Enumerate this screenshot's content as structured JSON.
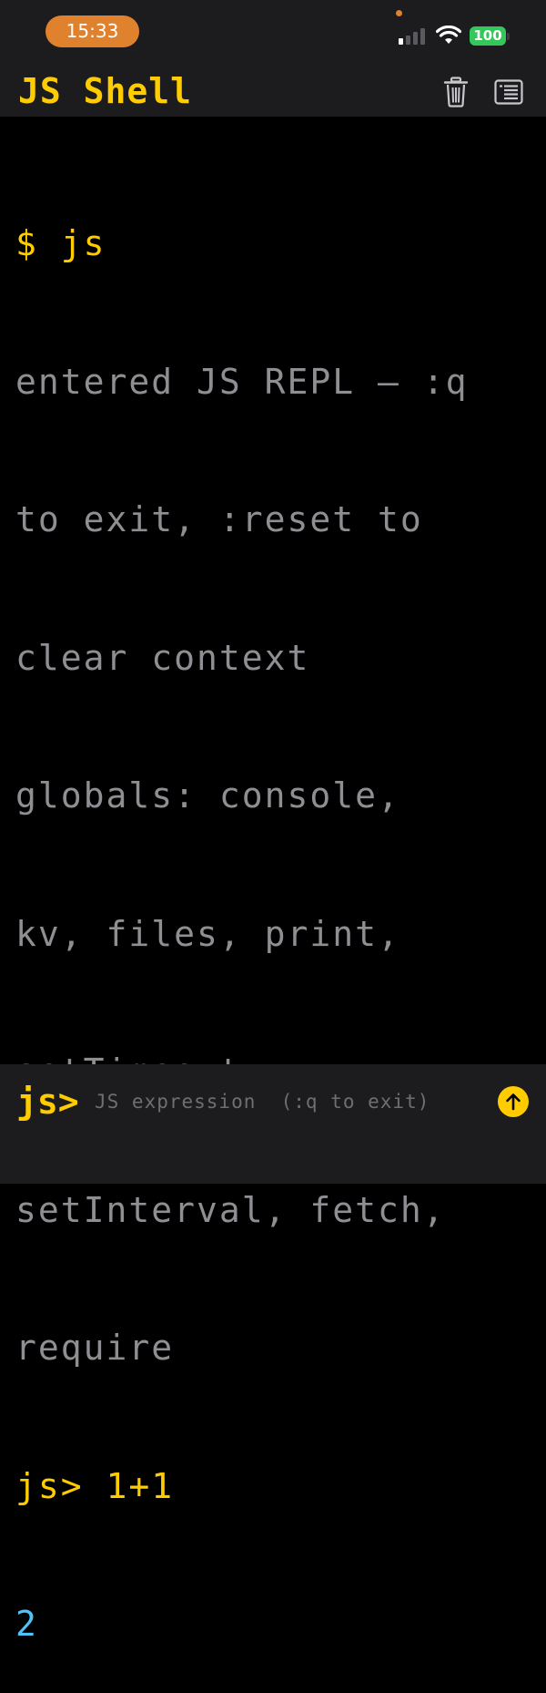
{
  "status_bar": {
    "time": "15:33",
    "battery": "100",
    "accent_color": "#e0812e",
    "battery_color": "#34c759",
    "signal_bars_active": 1,
    "signal_bars_total": 4
  },
  "header": {
    "title": "JS Shell",
    "icons": [
      "trash-icon",
      "log-list-icon"
    ]
  },
  "terminal": {
    "lines": [
      {
        "text": "$ js",
        "style": "command"
      },
      {
        "text": "entered JS REPL — :q",
        "style": "info"
      },
      {
        "text": "to exit, :reset to",
        "style": "info"
      },
      {
        "text": "clear context",
        "style": "info"
      },
      {
        "text": "globals: console,",
        "style": "info"
      },
      {
        "text": "kv, files, print,",
        "style": "info"
      },
      {
        "text": "setTimeout,",
        "style": "info"
      },
      {
        "text": "setInterval, fetch,",
        "style": "info"
      },
      {
        "text": "require",
        "style": "info"
      },
      {
        "text": "js> 1+1",
        "style": "command"
      },
      {
        "text": "2",
        "style": "result"
      }
    ]
  },
  "input_bar": {
    "prompt": "js>",
    "value": "",
    "placeholder": "JS expression  (:q to exit)",
    "send_icon": "arrow-up-icon"
  },
  "colors": {
    "accent": "#ffcc00",
    "info_text": "#8e8e93",
    "result": "#4fc3f7",
    "bar_background": "#1c1c1e",
    "background": "#000000"
  }
}
